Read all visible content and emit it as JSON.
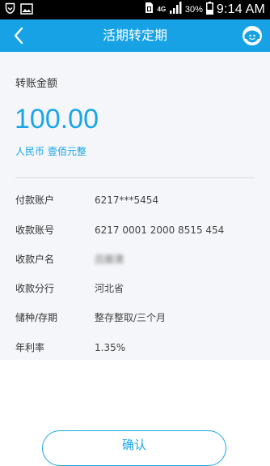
{
  "status_bar": {
    "network_type": "4G",
    "battery_percent": "30%",
    "time": "9:14 AM"
  },
  "header": {
    "title": "活期转定期",
    "back_icon": "back-chevron-icon",
    "service_icon": "customer-service-icon"
  },
  "amount": {
    "label": "转账金额",
    "value": "100.00",
    "in_words": "人民币 壹佰元整"
  },
  "details": [
    {
      "label": "付款账户",
      "value": "6217***5454"
    },
    {
      "label": "收款账号",
      "value": "6217 0001 2000 8515 454"
    },
    {
      "label": "收款户名",
      "value": "吕振清"
    },
    {
      "label": "收款分行",
      "value": "河北省"
    },
    {
      "label": "储种/存期",
      "value": "整存整取/三个月"
    },
    {
      "label": "年利率",
      "value": "1.35%"
    }
  ],
  "actions": {
    "confirm_label": "确认"
  },
  "colors": {
    "status_bar_bg": "#000000",
    "header_bg": "#17a2e6",
    "accent": "#19a6e6",
    "card_bg": "#f4f6f9",
    "page_bg": "#ffffff"
  }
}
